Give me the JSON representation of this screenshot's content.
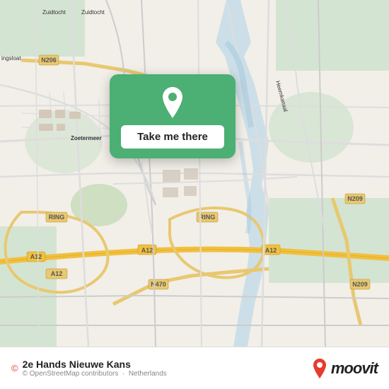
{
  "map": {
    "background_color": "#e8e0d8",
    "attribution": "© OpenStreetMap contributors"
  },
  "popup": {
    "button_label": "Take me there",
    "pin_color": "#ffffff",
    "bg_color": "#4caf73"
  },
  "bottom_bar": {
    "location_name": "2e Hands Nieuwe Kans",
    "country": "Netherlands",
    "attribution": "© OpenStreetMap contributors",
    "brand": "moovit"
  }
}
